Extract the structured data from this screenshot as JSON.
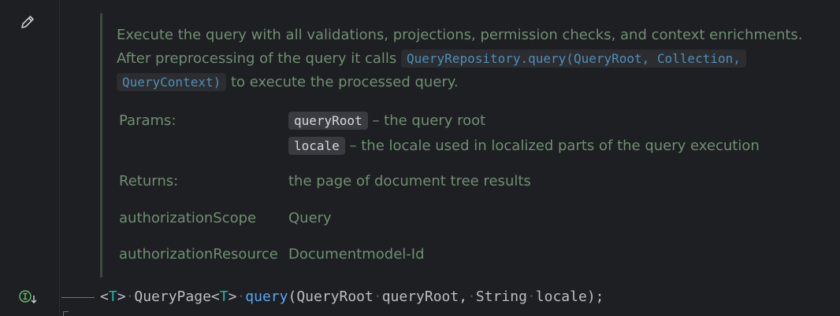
{
  "doc": {
    "description": {
      "text1": "Execute the query with all validations, projections, permission checks, and context enrichments.",
      "text2": "After preprocessing of the query it calls",
      "link1": "QueryRepository.query(QueryRoot, Collection,",
      "link2": "QueryContext)",
      "text3": "to execute the processed query."
    },
    "params": {
      "label": "Params:",
      "items": [
        {
          "name": "queryRoot",
          "desc": "– the query root"
        },
        {
          "name": "locale",
          "desc": "– the locale used in localized parts of the query execution"
        }
      ]
    },
    "returns": {
      "label": "Returns:",
      "value": "the page of document tree results"
    },
    "custom_tags": [
      {
        "label": "authorizationScope",
        "value": "Query"
      },
      {
        "label": "authorizationResource",
        "value": "Documentmodel-Id"
      }
    ]
  },
  "code_line": {
    "open_angle": "<",
    "type_param": "T",
    "close_angle": ">",
    "return_type_a": "QueryPage<",
    "return_type_b": ">",
    "method": "query",
    "paren_open": "(",
    "param1_type": "QueryRoot",
    "param1_name": "queryRoot,",
    "param2_type": "String",
    "param2_name": "locale",
    "end": ");"
  },
  "icons": {
    "edit": "pencil-icon",
    "implemented": "implemented-interface-icon"
  },
  "colors": {
    "background": "#1e1f22",
    "doc_text": "#6f8f72",
    "link": "#4f8fb8",
    "keyword_type": "#16baac",
    "method": "#56a8f5",
    "code_text": "#bcbec4"
  }
}
